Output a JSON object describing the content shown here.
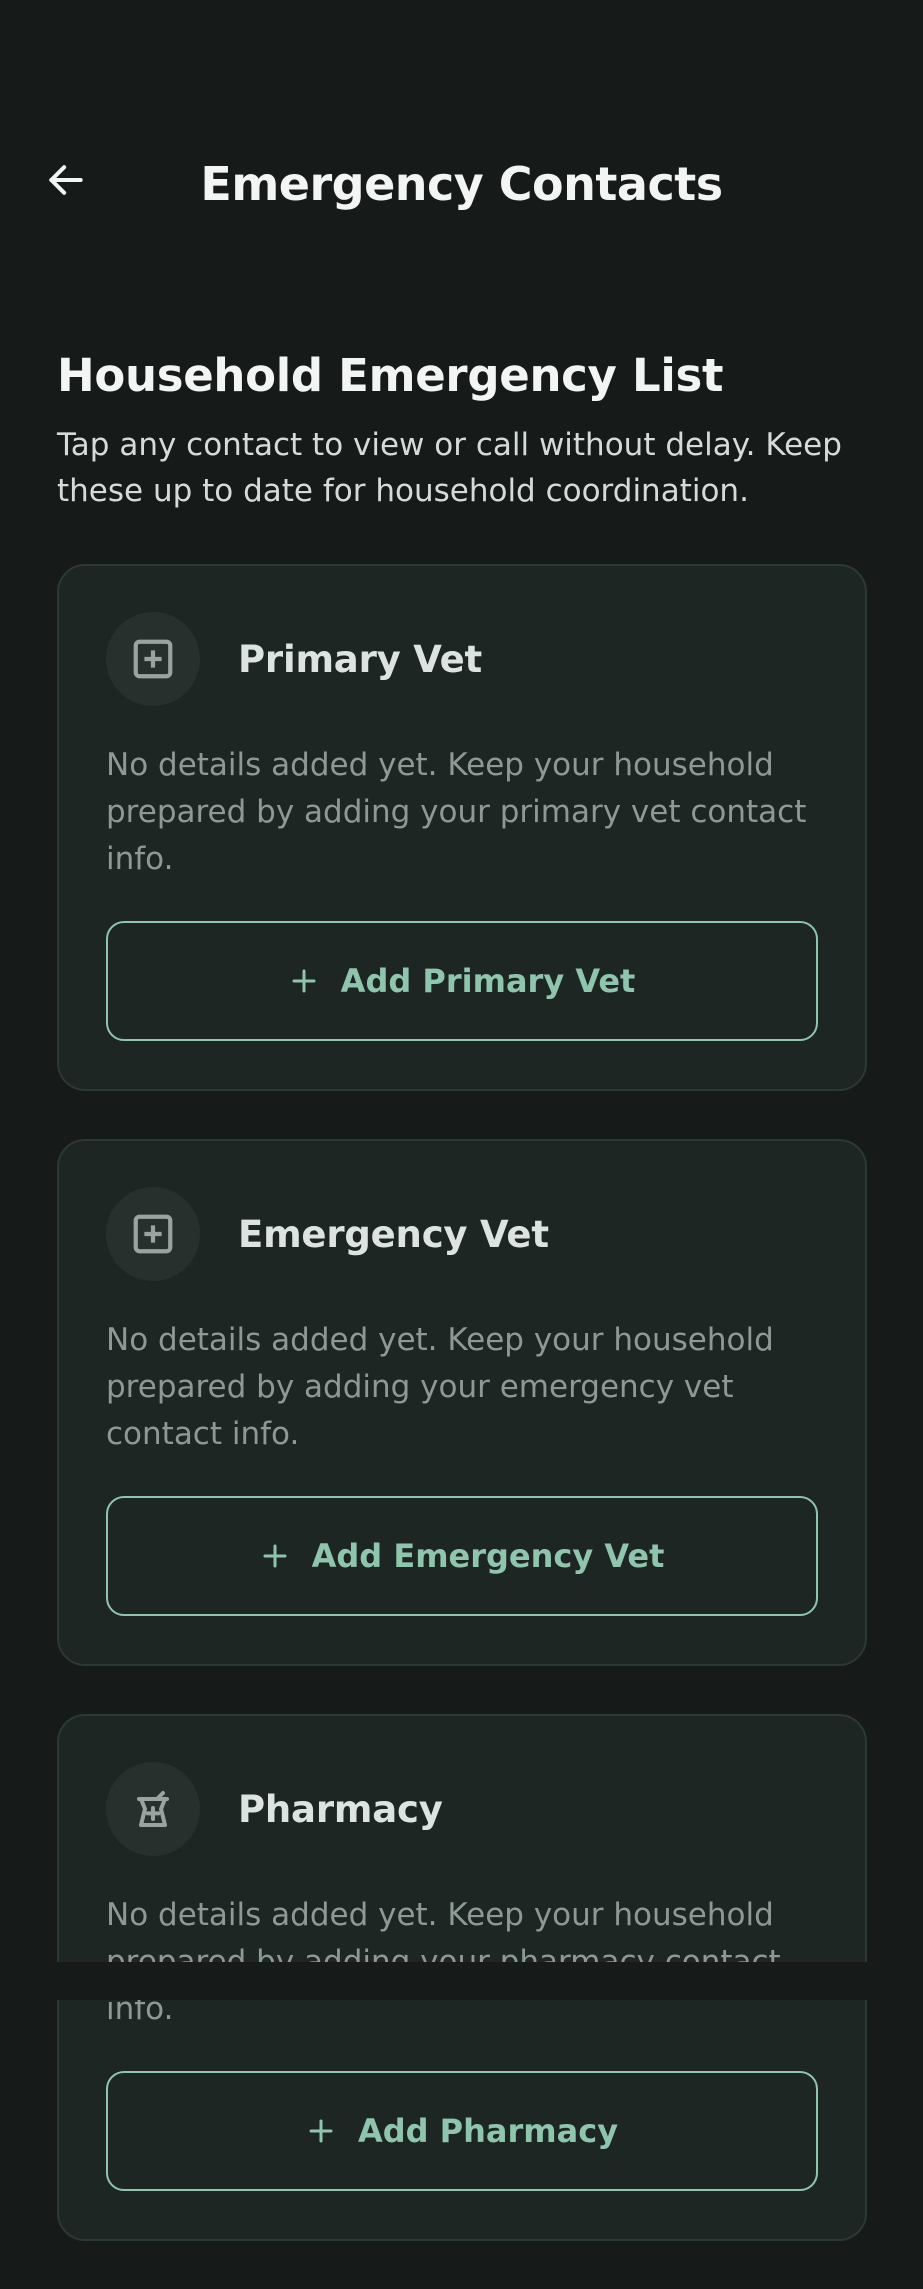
{
  "header": {
    "title": "Emergency Contacts",
    "back_icon": "arrow-left-icon"
  },
  "section": {
    "heading": "Household Emergency List",
    "description": "Tap any contact to view or call without delay. Keep these up to date for household coordination."
  },
  "cards": [
    {
      "title": "Primary Vet",
      "icon": "medical-cross-square-icon",
      "description": "No details added yet. Keep your household prepared by adding your primary vet contact info.",
      "button_label": "Add Primary Vet"
    },
    {
      "title": "Emergency Vet",
      "icon": "medical-cross-square-icon",
      "description": "No details added yet. Keep your household prepared by adding your emergency vet contact info.",
      "button_label": "Add Emergency Vet"
    },
    {
      "title": "Pharmacy",
      "icon": "pharmacy-jar-icon",
      "description": "No details added yet. Keep your household prepared by adding your pharmacy contact info.",
      "button_label": "Add Pharmacy"
    }
  ],
  "colors": {
    "background": "#161b1a",
    "card": "#1d2623",
    "accent": "#8fc5ad",
    "muted_text": "#8e9894"
  }
}
